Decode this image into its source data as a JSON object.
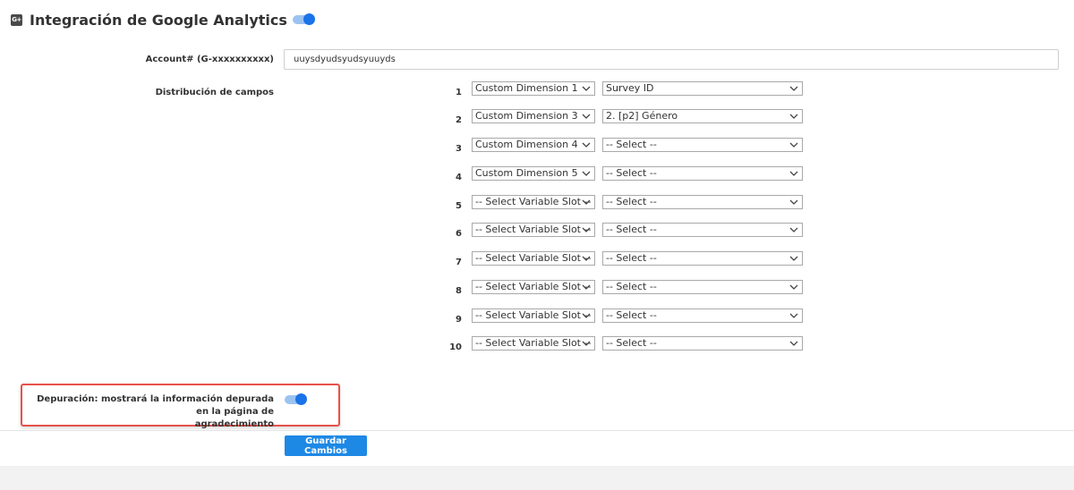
{
  "header": {
    "icon_text": "G+",
    "title": "Integración de Google Analytics",
    "enabled": true
  },
  "account": {
    "label": "Account# (G-xxxxxxxxxx)",
    "value": "uuysdyudsyudsyuuyds"
  },
  "distribution": {
    "label": "Distribución de campos",
    "rows": [
      {
        "num": "1",
        "slot": "Custom Dimension 1",
        "field": "Survey ID"
      },
      {
        "num": "2",
        "slot": "Custom Dimension 3",
        "field": "2. [p2] Género"
      },
      {
        "num": "3",
        "slot": "Custom Dimension 4",
        "field": "-- Select --"
      },
      {
        "num": "4",
        "slot": "Custom Dimension 5",
        "field": "-- Select --"
      },
      {
        "num": "5",
        "slot": "-- Select Variable Slot --",
        "field": "-- Select --"
      },
      {
        "num": "6",
        "slot": "-- Select Variable Slot --",
        "field": "-- Select --"
      },
      {
        "num": "7",
        "slot": "-- Select Variable Slot --",
        "field": "-- Select --"
      },
      {
        "num": "8",
        "slot": "-- Select Variable Slot --",
        "field": "-- Select --"
      },
      {
        "num": "9",
        "slot": "-- Select Variable Slot --",
        "field": "-- Select --"
      },
      {
        "num": "10",
        "slot": "-- Select Variable Slot --",
        "field": "-- Select --"
      }
    ]
  },
  "debug": {
    "label_line1": "Depuración: mostrará la información depurada en la página de",
    "label_line2": "agradecimiento",
    "enabled": true
  },
  "actions": {
    "save_label": "Guardar Cambios"
  },
  "colors": {
    "accent": "#1e88e5",
    "toggle_on": "#1a73e8",
    "highlight_border": "#e8514a"
  }
}
